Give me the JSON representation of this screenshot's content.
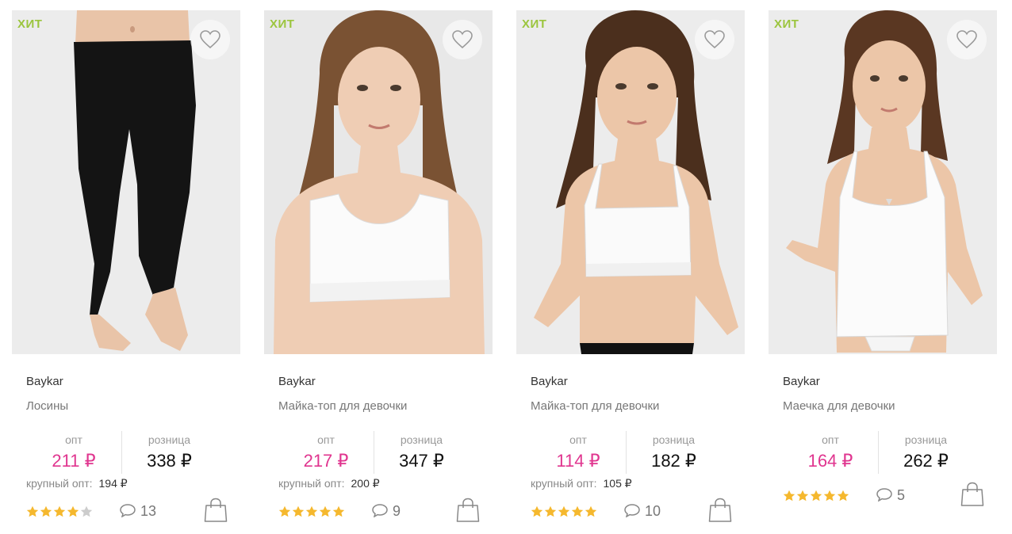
{
  "products": [
    {
      "badge": "ХИТ",
      "brand": "Baykar",
      "title": "Лосины",
      "opt_label": "опт",
      "opt_price": "211 ₽",
      "retail_label": "розница",
      "retail_price": "338 ₽",
      "bulk_label": "крупный опт:",
      "bulk_price": "194 ₽",
      "rating": 4,
      "reviews": "13",
      "image": "black-leggings-photo"
    },
    {
      "badge": "ХИТ",
      "brand": "Baykar",
      "title": "Майка-топ для девочки",
      "opt_label": "опт",
      "opt_price": "217 ₽",
      "retail_label": "розница",
      "retail_price": "347 ₽",
      "bulk_label": "крупный опт:",
      "bulk_price": "200 ₽",
      "rating": 5,
      "reviews": "9",
      "image": "girl-white-crop-top-photo"
    },
    {
      "badge": "ХИТ",
      "brand": "Baykar",
      "title": "Майка-топ для девочки",
      "opt_label": "опт",
      "opt_price": "114 ₽",
      "retail_label": "розница",
      "retail_price": "182 ₽",
      "bulk_label": "крупный опт:",
      "bulk_price": "105 ₽",
      "rating": 5,
      "reviews": "10",
      "image": "child-white-crop-top-photo"
    },
    {
      "badge": "ХИТ",
      "brand": "Baykar",
      "title": "Маечка для девочки",
      "opt_label": "опт",
      "opt_price": "164 ₽",
      "retail_label": "розница",
      "retail_price": "262 ₽",
      "bulk_label": "",
      "bulk_price": "",
      "rating": 5,
      "reviews": "5",
      "image": "child-white-camisole-photo"
    }
  ],
  "colors": {
    "badge": "#9bc53d",
    "opt_price": "#e0358f",
    "star_filled": "#f5b82e",
    "star_empty": "#cccccc"
  },
  "icons": {
    "favorite": "heart-outline-icon",
    "reviews": "speech-bubble-icon",
    "cart": "shopping-bag-icon",
    "rating": "star-icon"
  }
}
